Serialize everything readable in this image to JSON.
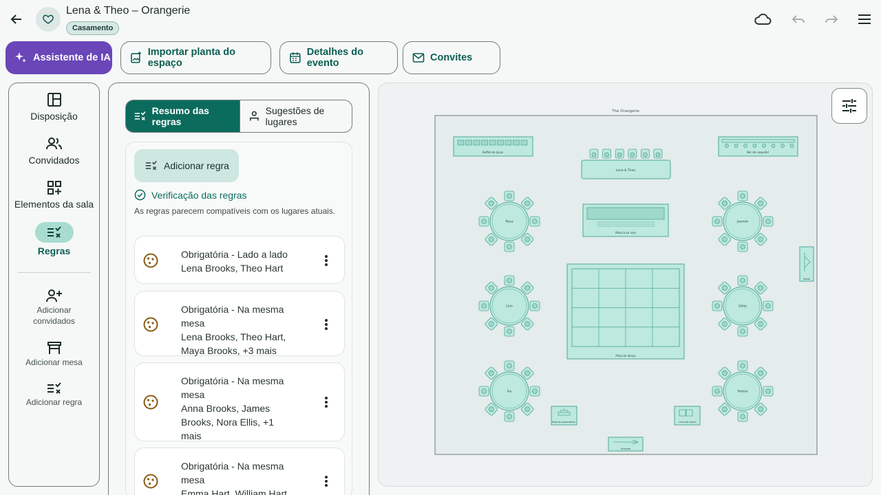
{
  "header": {
    "title": "Lena & Theo – Orangerie",
    "badge": "Casamento",
    "icons": {
      "back": "arrow-left-icon",
      "favorite": "heart-icon",
      "cloud": "cloud-icon",
      "undo": "undo-icon",
      "redo": "redo-icon",
      "menu": "menu-icon"
    }
  },
  "actions": {
    "ai": "Assistente de IA",
    "import": "Importar planta do espaço",
    "details": "Detalhes do evento",
    "invites": "Convites"
  },
  "rail": {
    "items": [
      {
        "label": "Disposição",
        "icon": "layout-icon"
      },
      {
        "label": "Convidados",
        "icon": "people-icon"
      },
      {
        "label": "Elementos da sala",
        "icon": "grid-add-icon"
      },
      {
        "label": "Regras",
        "icon": "rules-icon",
        "active": true
      }
    ],
    "quick": [
      {
        "label": "Adicionar convidados",
        "icon": "person-add-icon"
      },
      {
        "label": "Adicionar mesa",
        "icon": "table-icon"
      },
      {
        "label": "Adicionar regra",
        "icon": "rule-add-icon"
      }
    ]
  },
  "panel": {
    "tab_active": "Resumo das regras",
    "tab_inactive": "Sugestões de lugares",
    "add_rule": "Adicionar regra",
    "check_title": "Verificação das regras",
    "check_text": "As regras parecem compatíveis com os lugares atuais.",
    "rules": [
      {
        "title": "Obrigatória - Lado a lado",
        "people": "Lena Brooks, Theo Hart"
      },
      {
        "title": "Obrigatória - Na mesma mesa",
        "people": "Lena Brooks, Theo Hart, Maya Brooks, +3 mais"
      },
      {
        "title": "Obrigatória - Na mesma mesa",
        "people": "Anna Brooks, James Brooks, Nora Ellis, +1 mais"
      },
      {
        "title": "Obrigatória - Na mesma mesa",
        "people": "Emma Hart, William Hart"
      }
    ]
  },
  "floor": {
    "venue": "The Orangerie",
    "elements": {
      "gifts": "Buffet de joyas",
      "head": "Lena & Theo",
      "bar": "Bar de coquetel",
      "music": "Música ao vivo",
      "dance": "Pista de dança",
      "cake": "Bolo de casamento",
      "guestbook": "Livro de honra",
      "exit": "Saída",
      "entrance": "Entrada"
    },
    "tables": [
      "Rosa",
      "Jasmim",
      "Lírio",
      "Dália",
      "Íris",
      "Peônia"
    ]
  },
  "colors": {
    "primary": "#0b6b5d",
    "ai": "#6a46b8",
    "table_fill": "#bde9df",
    "table_stroke": "#4fa896",
    "rule_icon": "#8a5a12"
  }
}
